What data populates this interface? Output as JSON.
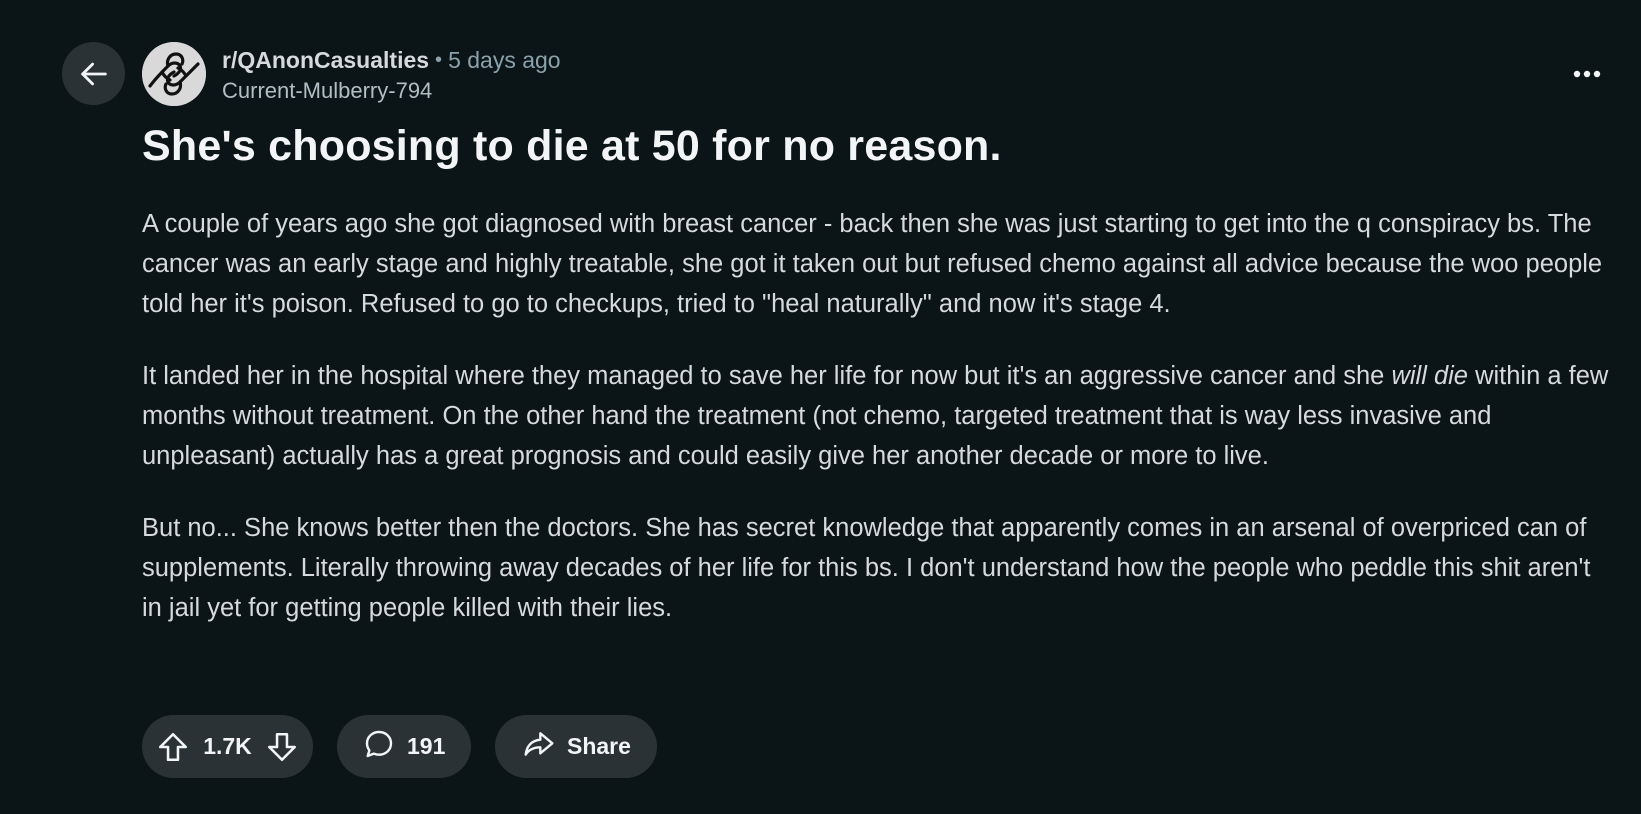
{
  "header": {
    "back_icon": "arrow-left-icon",
    "avatar_icon": "subreddit-avatar-icon",
    "subreddit": "r/QAnonCasualties",
    "separator": "•",
    "time_ago": "5 days ago",
    "author": "Current-Mulberry-794",
    "more_icon": "ellipsis-icon"
  },
  "post": {
    "title": "She's choosing to die at 50 for no reason.",
    "paragraph1": "A couple of years ago she got diagnosed with breast cancer - back then she was just starting to get into the q conspiracy bs. The cancer was an early stage and highly treatable, she got it taken out but refused chemo against all advice because the woo people told her it's poison. Refused to go to checkups, tried to \"heal naturally\" and now it's stage 4.",
    "paragraph2_before": "It landed her in the hospital where they managed to save her life for now but it's an aggressive cancer and she ",
    "paragraph2_emphasis": "will die",
    "paragraph2_after": " within a few months without treatment. On the other hand the treatment (not chemo, targeted treatment that is way less invasive and unpleasant) actually has a great prognosis and could easily give her another decade or more to live.",
    "paragraph3": "But no... She knows better then the doctors. She has secret knowledge that apparently comes in an arsenal of overpriced can of supplements. Literally throwing away decades of her life for this bs. I don't understand how the people who peddle this shit aren't in jail yet for getting people killed with their lies."
  },
  "actions": {
    "upvote_icon": "upvote-arrow-icon",
    "vote_count": "1.7K",
    "downvote_icon": "downvote-arrow-icon",
    "comment_icon": "speech-bubble-icon",
    "comment_count": "191",
    "share_icon": "share-arrow-icon",
    "share_label": "Share"
  },
  "colors": {
    "background": "#0b1416",
    "pill": "#2a3236",
    "text_primary": "#f2f4f5",
    "text_secondary": "#8ba2ad"
  }
}
